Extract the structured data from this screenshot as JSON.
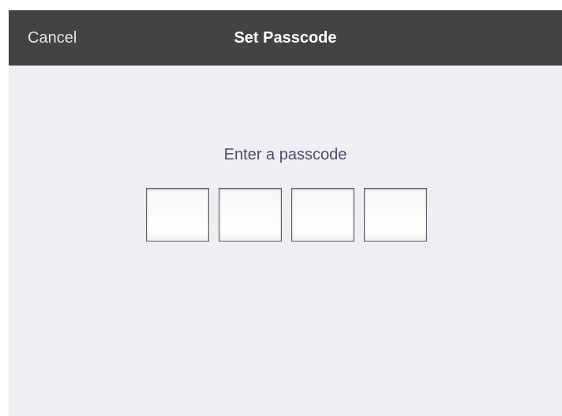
{
  "navbar": {
    "cancel_label": "Cancel",
    "title": "Set Passcode",
    "background_color": "#434343"
  },
  "prompt": {
    "text": "Enter a passcode"
  },
  "passcode": {
    "digit_count": 4,
    "entered_digits": [
      "",
      "",
      "",
      ""
    ]
  },
  "colors": {
    "page_background": "#efeef4",
    "prompt_text": "#4a4e6a"
  }
}
